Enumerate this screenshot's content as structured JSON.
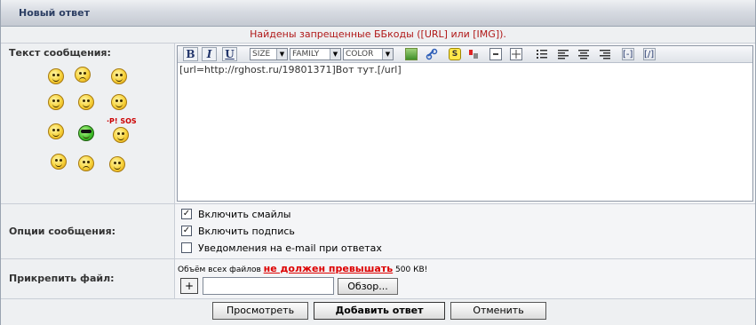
{
  "header": {
    "title": "Новый ответ"
  },
  "error": {
    "message": "Найдены запрещенные ББкоды ([URL] или [IMG])."
  },
  "message_row": {
    "label": "Текст сообщения:",
    "sos_text": "·P! SOS"
  },
  "toolbar": {
    "bold": "B",
    "italic": "I",
    "underline": "U",
    "size_select": "SIZE",
    "family_select": "FAMILY",
    "color_select": "COLOR",
    "icons": [
      "image-icon",
      "link-icon",
      "spoiler-icon",
      "quote-icon",
      "code-icon",
      "table-icon",
      "list-icon",
      "align-left-icon",
      "align-center-icon",
      "align-right-icon",
      "hide-icon",
      "offtop-icon"
    ],
    "small_codes": {
      "hide": "[-]",
      "offtop": "[/]"
    }
  },
  "editor": {
    "text": "[url=http://rghost.ru/19801371]Вот тут.[/url]"
  },
  "options_row": {
    "label": "Опции сообщения:",
    "options": [
      {
        "label": "Включить смайлы",
        "checked": true
      },
      {
        "label": "Включить подпись",
        "checked": true
      },
      {
        "label": "Уведомления на e-mail при ответах",
        "checked": false
      }
    ]
  },
  "attach_row": {
    "label": "Прикрепить файл:",
    "note_prefix": "Объём всех файлов",
    "note_warn": "не должен превышать",
    "note_suffix": "500 КВ!",
    "plus": "+",
    "file_value": "",
    "browse": "Обзор..."
  },
  "buttons": {
    "preview": "Просмотреть",
    "submit": "Добавить ответ",
    "cancel": "Отменить"
  },
  "colors": {
    "accent": "#2c3e63",
    "error": "#b01818",
    "warn": "#dd0000"
  }
}
